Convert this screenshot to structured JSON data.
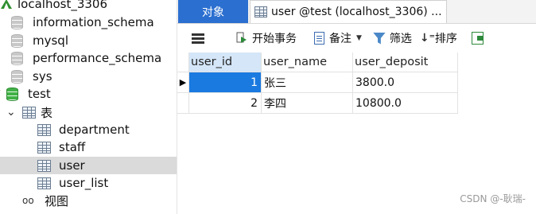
{
  "tree": {
    "connection": "localhost_3306",
    "databases": [
      "information_schema",
      "mysql",
      "performance_schema",
      "sys",
      "test"
    ],
    "tables_group": "表",
    "tables": [
      "department",
      "staff",
      "user",
      "user_list"
    ],
    "selected_table": "user",
    "views_group": "视图"
  },
  "tabs": {
    "objects": "对象",
    "active": "user @test (localhost_3306) ..."
  },
  "toolbar": {
    "begin_transaction": "开始事务",
    "memo": "备注",
    "filter": "筛选",
    "sort": "排序"
  },
  "grid": {
    "columns": [
      "user_id",
      "user_name",
      "user_deposit"
    ],
    "rows": [
      {
        "user_id": "1",
        "user_name": "张三",
        "user_deposit": "3800.0"
      },
      {
        "user_id": "2",
        "user_name": "李四",
        "user_deposit": "10800.0"
      }
    ]
  },
  "watermark": "CSDN @-耿瑞-",
  "colors": {
    "accent": "#2b6fd0",
    "selected_cell": "#1a7ae0",
    "db_green": "#41b146"
  }
}
